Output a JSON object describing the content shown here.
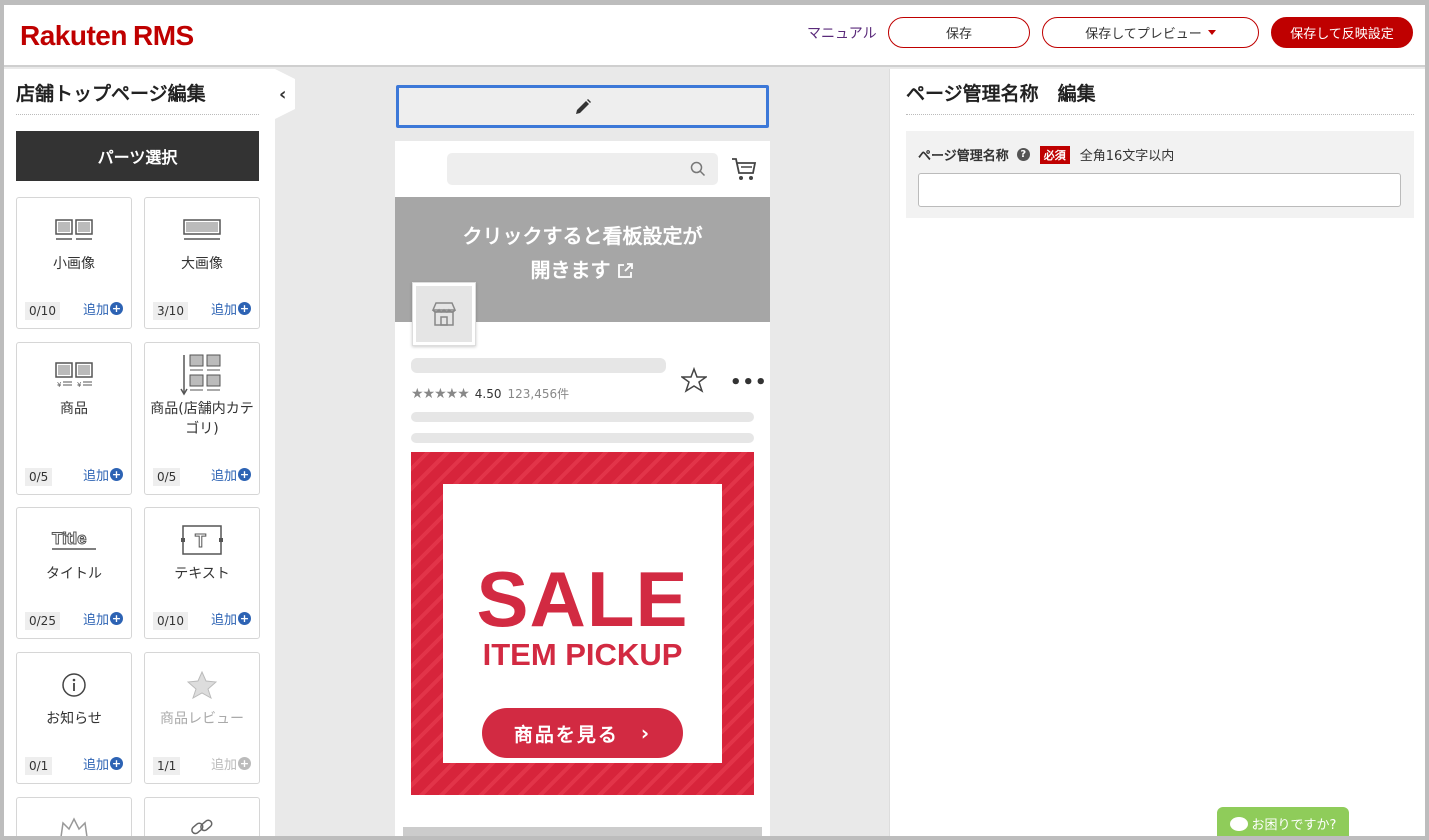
{
  "header": {
    "logo_brand": "Rakuten",
    "logo_product": "RMS",
    "manual_label": "マニュアル",
    "save_label": "保存",
    "preview_label": "保存してプレビュー",
    "publish_label": "保存して反映設定"
  },
  "sidebar": {
    "title": "店舗トップページ編集",
    "parts_button": "パーツ選択",
    "add_label": "追加",
    "cards": [
      {
        "label": "小画像",
        "count": "0/10",
        "icon": "small-image-icon"
      },
      {
        "label": "大画像",
        "count": "3/10",
        "icon": "large-image-icon"
      },
      {
        "label": "商品",
        "count": "0/5",
        "icon": "product-icon"
      },
      {
        "label": "商品(店舗内カテゴリ)",
        "count": "0/5",
        "icon": "product-category-icon"
      },
      {
        "label": "タイトル",
        "count": "0/25",
        "icon": "title-icon"
      },
      {
        "label": "テキスト",
        "count": "0/10",
        "icon": "text-icon"
      },
      {
        "label": "お知らせ",
        "count": "0/1",
        "icon": "info-icon"
      },
      {
        "label": "商品レビュー",
        "count": "1/1",
        "icon": "star-icon",
        "disabled": true
      }
    ]
  },
  "preview": {
    "banner_line1": "クリックすると看板設定が",
    "banner_line2": "開きます",
    "rating_value": "4.50",
    "rating_count": "123,456件",
    "stars": "★★★★★",
    "sale_title": "SALE",
    "sale_subtitle": "ITEM PICKUP",
    "sale_button": "商品を見る"
  },
  "right_panel": {
    "title": "ページ管理名称　編集",
    "field_label": "ページ管理名称",
    "required_badge": "必須",
    "hint": "全角16文字以内",
    "input_value": ""
  },
  "help_button": "お困りですか?",
  "colors": {
    "brand": "#bf0000",
    "link_blue": "#2d63b4",
    "sale_red": "#d22a42",
    "edit_focus": "#3c78d8",
    "help_green": "#8fcc5a"
  }
}
